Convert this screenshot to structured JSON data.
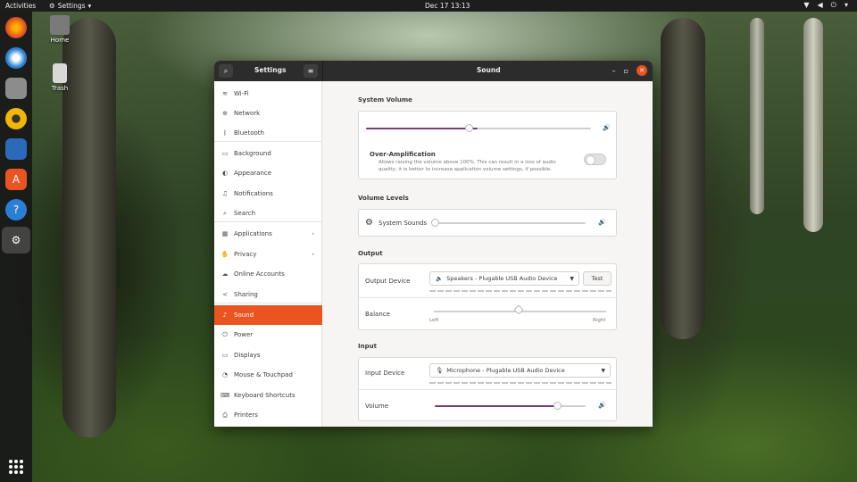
{
  "topbar": {
    "activities": "Activities",
    "app_menu": "Settings",
    "clock": "Dec 17  13:13"
  },
  "desktop": {
    "home_label": "Home",
    "trash_label": "Trash"
  },
  "window": {
    "sidebar_title": "Settings",
    "title": "Sound"
  },
  "sidebar": {
    "items": [
      {
        "label": "Wi-Fi",
        "icon": "wifi-icon",
        "glyph": "≋"
      },
      {
        "label": "Network",
        "icon": "network-icon",
        "glyph": "⊕"
      },
      {
        "label": "Bluetooth",
        "icon": "bluetooth-icon",
        "glyph": "ᛒ"
      },
      {
        "label": "Background",
        "icon": "background-icon",
        "glyph": "▭"
      },
      {
        "label": "Appearance",
        "icon": "appearance-icon",
        "glyph": "◐"
      },
      {
        "label": "Notifications",
        "icon": "bell-icon",
        "glyph": "♫"
      },
      {
        "label": "Search",
        "icon": "search-icon",
        "glyph": "⌕"
      },
      {
        "label": "Applications",
        "icon": "applications-icon",
        "glyph": "▦"
      },
      {
        "label": "Privacy",
        "icon": "privacy-icon",
        "glyph": "✋"
      },
      {
        "label": "Online Accounts",
        "icon": "online-accounts-icon",
        "glyph": "☁"
      },
      {
        "label": "Sharing",
        "icon": "sharing-icon",
        "glyph": "<"
      },
      {
        "label": "Sound",
        "icon": "music-note-icon",
        "glyph": "♪"
      },
      {
        "label": "Power",
        "icon": "power-icon",
        "glyph": "⏻"
      },
      {
        "label": "Displays",
        "icon": "display-icon",
        "glyph": "▭"
      },
      {
        "label": "Mouse & Touchpad",
        "icon": "mouse-icon",
        "glyph": "◔"
      },
      {
        "label": "Keyboard Shortcuts",
        "icon": "keyboard-icon",
        "glyph": "⌨"
      },
      {
        "label": "Printers",
        "icon": "printer-icon",
        "glyph": "⎙"
      }
    ],
    "active": "Sound"
  },
  "sound": {
    "system_volume": {
      "title": "System Volume",
      "level": 0.5,
      "over_amplification_label": "Over-Amplification",
      "over_amplification_desc_1": "Allows raising the volume above 100%. This can result in a loss of audio",
      "over_amplification_desc_2": "quality; it is better to increase application volume settings, if possible.",
      "over_amplification_enabled": false
    },
    "volume_levels": {
      "title": "Volume Levels",
      "system_sounds_label": "System Sounds",
      "system_sounds_level": 0.0
    },
    "output": {
      "title": "Output",
      "device_label": "Output Device",
      "device_value": "Speakers - Plugable USB Audio Device",
      "test_label": "Test",
      "balance_label": "Balance",
      "balance_value": 0.5,
      "left_label": "Left",
      "right_label": "Right"
    },
    "input": {
      "title": "Input",
      "device_label": "Input Device",
      "device_value": "Microphone - Plugable USB Audio Device",
      "volume_label": "Volume",
      "volume_level": 0.8
    }
  },
  "colors": {
    "accent": "#e95420",
    "slider_fill": "#7a3a7a",
    "headerbar": "#2c2c2c"
  }
}
